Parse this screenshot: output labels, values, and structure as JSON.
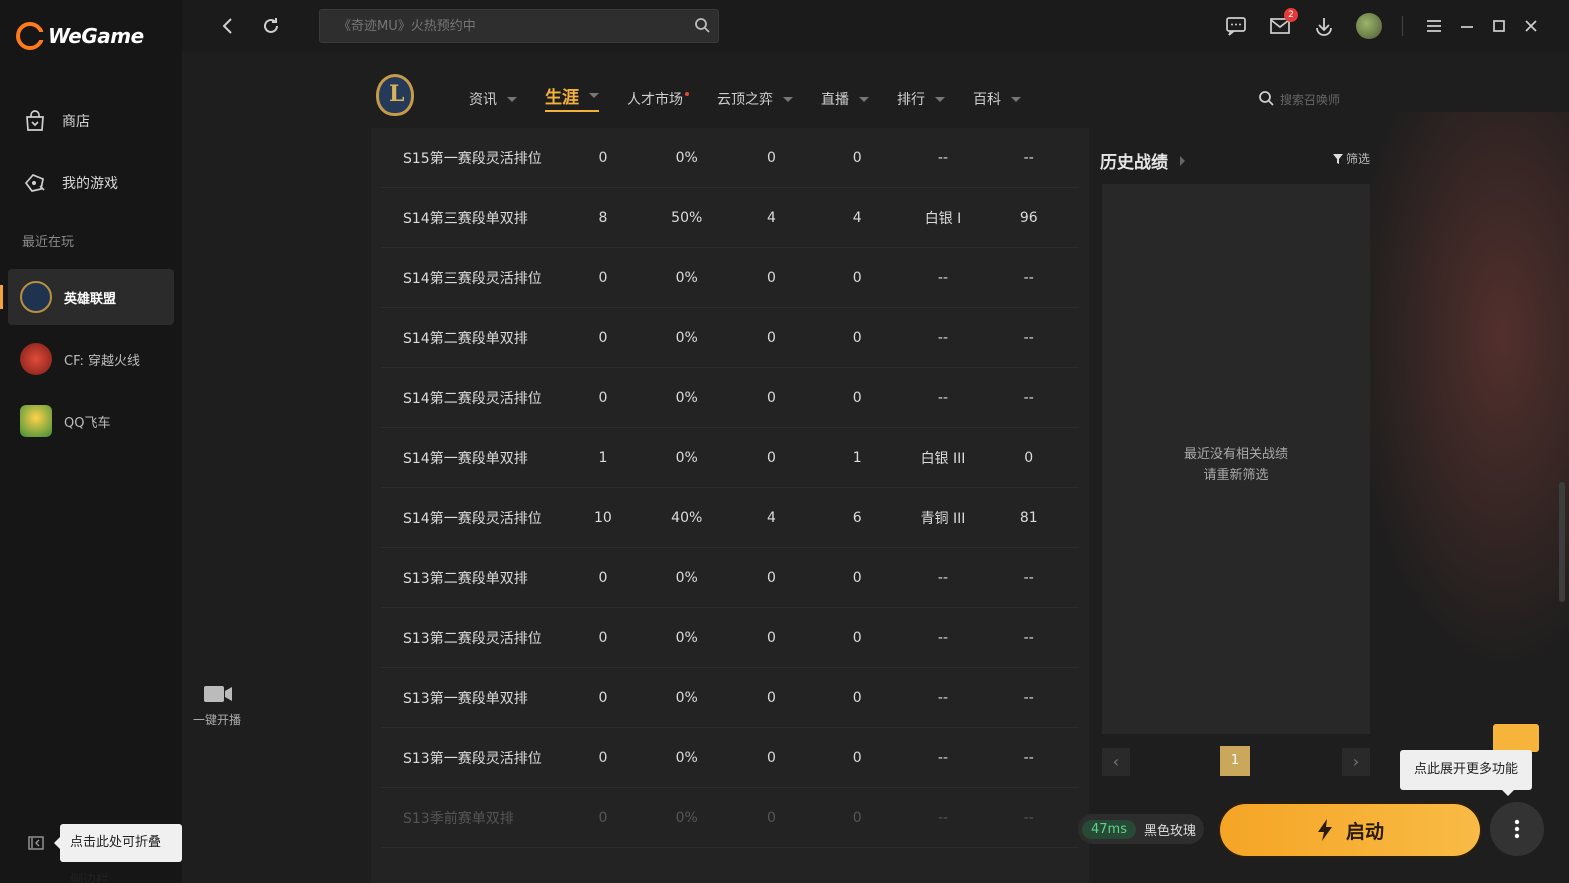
{
  "app": {
    "logo_text": "WeGame"
  },
  "sidebar": {
    "nav": [
      {
        "label": "商店",
        "icon": "shop-bag-icon"
      },
      {
        "label": "我的游戏",
        "icon": "gamepad-icon"
      }
    ],
    "recent_label": "最近在玩",
    "games": [
      {
        "label": "英雄联盟",
        "active": true
      },
      {
        "label": "CF: 穿越火线",
        "active": false
      },
      {
        "label": "QQ飞车",
        "active": false
      }
    ],
    "collapse_tip": "点击此处可折叠侧边栏"
  },
  "topbar": {
    "search_placeholder": "《奇迹MU》火热预约中",
    "mail_badge": "2"
  },
  "lol": {
    "tabs": [
      {
        "label": "资讯",
        "caret": true
      },
      {
        "label": "生涯",
        "caret": true,
        "active": true
      },
      {
        "label": "人才市场",
        "dot": true
      },
      {
        "label": "云顶之弈",
        "caret": true
      },
      {
        "label": "直播",
        "caret": true
      },
      {
        "label": "排行",
        "caret": true
      },
      {
        "label": "百科",
        "caret": true
      }
    ],
    "search_placeholder": "搜索召唤师"
  },
  "rank_table": {
    "rows": [
      [
        "S15第一赛段灵活排位",
        "0",
        "0%",
        "0",
        "0",
        "--",
        "--"
      ],
      [
        "S14第三赛段单双排",
        "8",
        "50%",
        "4",
        "4",
        "白银 I",
        "96"
      ],
      [
        "S14第三赛段灵活排位",
        "0",
        "0%",
        "0",
        "0",
        "--",
        "--"
      ],
      [
        "S14第二赛段单双排",
        "0",
        "0%",
        "0",
        "0",
        "--",
        "--"
      ],
      [
        "S14第二赛段灵活排位",
        "0",
        "0%",
        "0",
        "0",
        "--",
        "--"
      ],
      [
        "S14第一赛段单双排",
        "1",
        "0%",
        "0",
        "1",
        "白银 III",
        "0"
      ],
      [
        "S14第一赛段灵活排位",
        "10",
        "40%",
        "4",
        "6",
        "青铜 III",
        "81"
      ],
      [
        "S13第二赛段单双排",
        "0",
        "0%",
        "0",
        "0",
        "--",
        "--"
      ],
      [
        "S13第二赛段灵活排位",
        "0",
        "0%",
        "0",
        "0",
        "--",
        "--"
      ],
      [
        "S13第一赛段单双排",
        "0",
        "0%",
        "0",
        "0",
        "--",
        "--"
      ],
      [
        "S13第一赛段灵活排位",
        "0",
        "0%",
        "0",
        "0",
        "--",
        "--"
      ],
      [
        "S13季前赛单双排",
        "0",
        "0%",
        "0",
        "0",
        "--",
        "--"
      ]
    ]
  },
  "history": {
    "title": "历史战绩",
    "filter_label": "筛选",
    "empty_line1": "最近没有相关战绩",
    "empty_line2": "请重新筛选",
    "page": "1"
  },
  "stream": {
    "label": "一键开播"
  },
  "bottom": {
    "ping": "47ms",
    "server": "黑色玫瑰",
    "launch_label": "启动",
    "more_tip": "点此展开更多功能"
  },
  "colors": {
    "accent": "#f3b23c",
    "launch": "#f5a526",
    "ping_green": "#5fd18d"
  }
}
